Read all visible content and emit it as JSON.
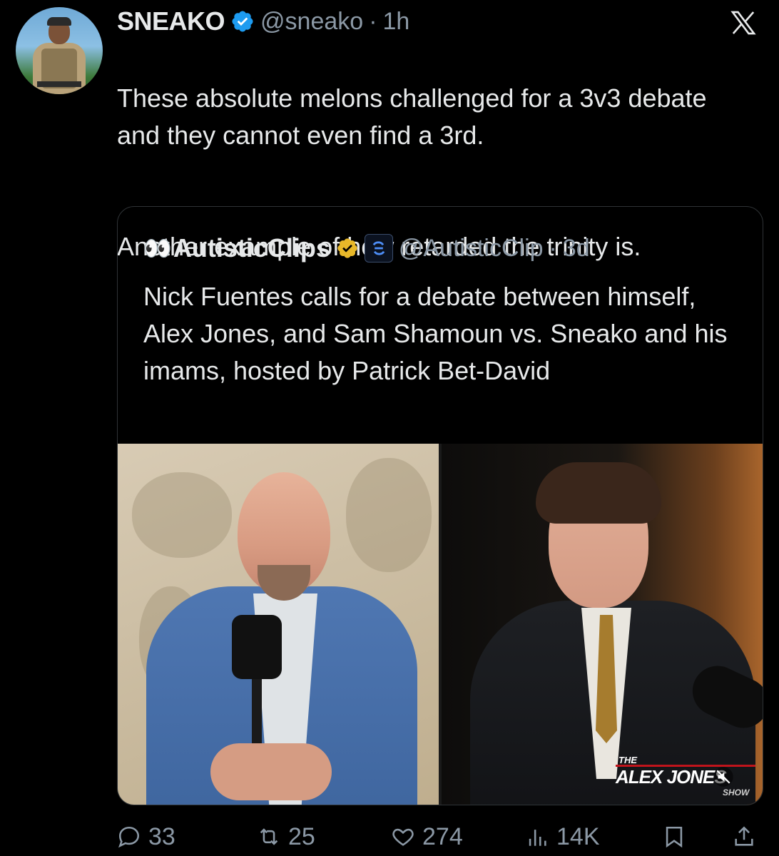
{
  "tweet": {
    "author_name": "SNEAKO",
    "handle": "@sneako",
    "separator": "·",
    "time": "1h",
    "text_paragraph_1": "These absolute melons challenged for a 3v3 debate and they cannot even find a 3rd.",
    "text_paragraph_2": "Another example of how retarded the trinity is."
  },
  "quoted_tweet": {
    "emoji": "👀",
    "author_name": "AutisticClips",
    "handle": "@AutisticClip",
    "separator": "·",
    "time": "3d",
    "text": "Nick Fuentes calls for a debate between himself, Alex Jones, and Sam Shamoun vs. Sneako and his imams, hosted by Patrick Bet-David",
    "media_watermark": {
      "the": "THE",
      "name": "ALEX JONES",
      "show": "SHOW"
    }
  },
  "actions": {
    "replies": "33",
    "reposts": "25",
    "likes": "274",
    "views": "14K"
  },
  "colors": {
    "background": "#000000",
    "text_primary": "#e7e9ea",
    "text_secondary": "#8b98a5",
    "verified_blue": "#1d9bf0",
    "verified_gold": "#e8b829",
    "border": "#2f3336"
  },
  "icons": [
    "x-logo-icon",
    "verified-badge-icon",
    "gold-verified-badge-icon",
    "affiliate-badge-icon",
    "reply-icon",
    "repost-icon",
    "like-icon",
    "views-icon",
    "bookmark-icon",
    "share-icon",
    "mute-icon"
  ]
}
